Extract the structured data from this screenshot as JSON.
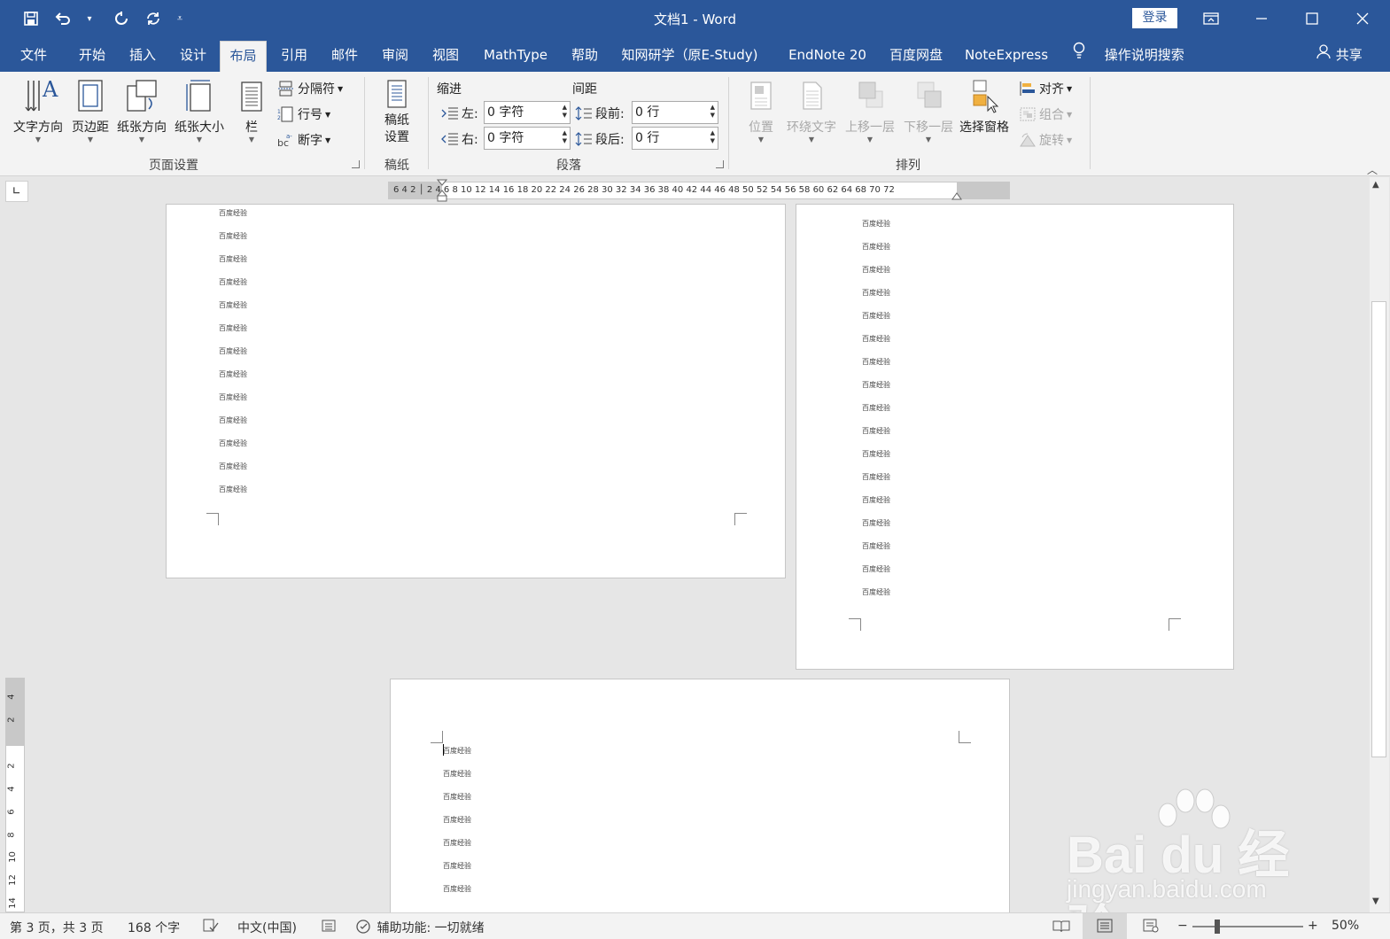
{
  "window": {
    "title": "文档1  -  Word",
    "login_label": "登录",
    "share_label": "共享"
  },
  "tabs": [
    {
      "label": "文件"
    },
    {
      "label": "开始"
    },
    {
      "label": "插入"
    },
    {
      "label": "设计"
    },
    {
      "label": "布局",
      "active": true
    },
    {
      "label": "引用"
    },
    {
      "label": "邮件"
    },
    {
      "label": "审阅"
    },
    {
      "label": "视图"
    },
    {
      "label": "MathType"
    },
    {
      "label": "帮助"
    },
    {
      "label": "知网研学（原E-Study)"
    },
    {
      "label": "EndNote 20"
    },
    {
      "label": "百度网盘"
    },
    {
      "label": "NoteExpress"
    },
    {
      "label": "操作说明搜索"
    }
  ],
  "ribbon": {
    "page_setup": {
      "group_label": "页面设置",
      "text_direction": "文字方向",
      "margins": "页边距",
      "orientation": "纸张方向",
      "size": "纸张大小",
      "columns": "栏",
      "breaks": "分隔符",
      "line_numbers": "行号",
      "hyphenation": "断字"
    },
    "manuscript": {
      "group_label": "稿纸",
      "settings_line1": "稿纸",
      "settings_line2": "设置"
    },
    "paragraph": {
      "group_label": "段落",
      "indent_header": "缩进",
      "spacing_header": "间距",
      "left_label": "左:",
      "left_value": "0 字符",
      "right_label": "右:",
      "right_value": "0 字符",
      "before_label": "段前:",
      "before_value": "0 行",
      "after_label": "段后:",
      "after_value": "0 行"
    },
    "arrange": {
      "group_label": "排列",
      "position": "位置",
      "wrap_text": "环绕文字",
      "bring_forward": "上移一层",
      "send_backward": "下移一层",
      "selection_pane": "选择窗格",
      "align": "对齐",
      "group": "组合",
      "rotate": "旋转"
    }
  },
  "ruler": {
    "horizontal_labels": "6  4  2  │  2  4  6  8 10 12 14 16 18 20 22 24 26 28 30 32 34 36 38 40 42 44 46 48 50 52 54 56 58 60 62 64  68 70 72",
    "vertical_labels": [
      "4",
      "2",
      "2",
      "4",
      "6",
      "8",
      "10",
      "12",
      "14"
    ]
  },
  "document": {
    "line_text": "百度经验",
    "page1_lines": 13,
    "page2_lines": 17,
    "page3_lines": 7
  },
  "statusbar": {
    "page_info": "第 3 页，共 3 页",
    "word_count": "168 个字",
    "language": "中文(中国)",
    "accessibility": "辅助功能: 一切就绪",
    "zoom_minus": "−",
    "zoom_plus": "+",
    "zoom_level": "50%",
    "zoom_fraction": 0.5
  },
  "watermark": {
    "brand": "Bai du 经验",
    "url": "jingyan.baidu.com"
  },
  "colors": {
    "title_bar": "#2b579a",
    "ribbon_bg": "#f3f3f3",
    "workspace_bg": "#e6e6e6"
  }
}
